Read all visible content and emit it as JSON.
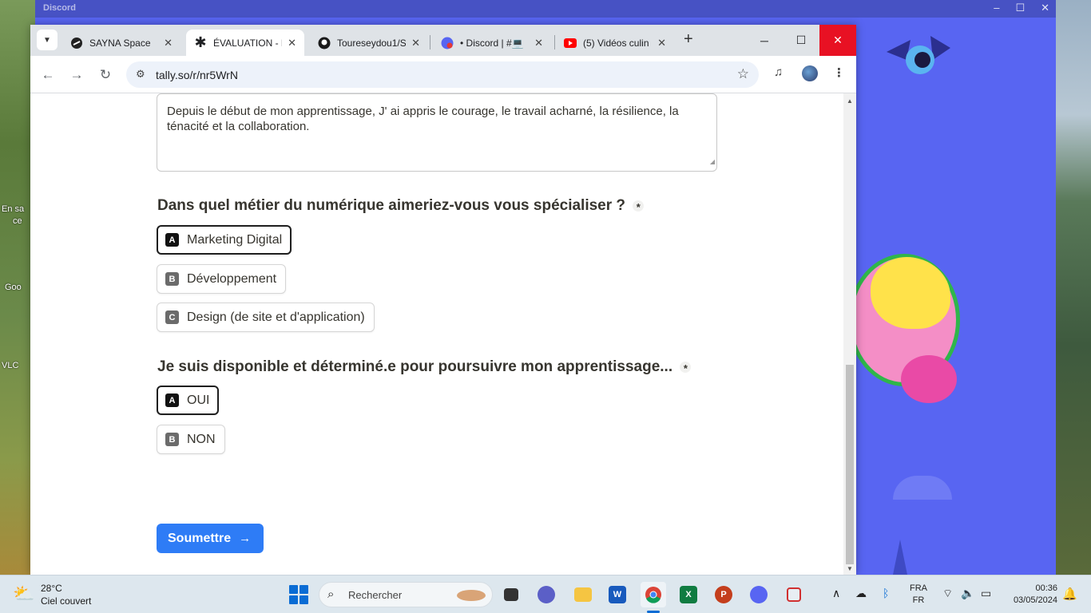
{
  "desktop": {
    "labels": [
      "En sa",
      "ce",
      "Goo",
      "VLC"
    ]
  },
  "discord": {
    "title": "Discord",
    "controls": [
      "–",
      "☐",
      "✕"
    ]
  },
  "browser": {
    "tabs": [
      {
        "title": "SAYNA Space",
        "favicon": "sayna-icon"
      },
      {
        "title": "ÉVALUATION - D",
        "favicon": "asterisk-icon",
        "active": true
      },
      {
        "title": "Toureseydou1/S",
        "favicon": "github-icon"
      },
      {
        "title": "• Discord | #💻",
        "favicon": "discord-icon"
      },
      {
        "title": "(5) Vidéos culin",
        "favicon": "youtube-icon"
      }
    ],
    "tab_close": "✕",
    "new_tab": "+",
    "window_controls": {
      "minimize": "─",
      "maximize": "☐",
      "close": "✕"
    },
    "url": "tally.so/r/nr5WrN"
  },
  "form": {
    "previous_answer": "Depuis le début de mon apprentissage, J' ai appris le courage, le travail acharné, la résilience, la ténacité et la collaboration.",
    "q1": {
      "text": "Dans quel métier du numérique aimeriez-vous vous spécialiser ?",
      "required_mark": "*",
      "options": [
        {
          "key": "A",
          "label": "Marketing Digital",
          "selected": true
        },
        {
          "key": "B",
          "label": "Développement",
          "selected": false
        },
        {
          "key": "C",
          "label": "Design (de site et d'application)",
          "selected": false
        }
      ]
    },
    "q2": {
      "text": "Je suis disponible et déterminé.e pour poursuivre mon apprentissage...",
      "required_mark": "*",
      "options": [
        {
          "key": "A",
          "label": "OUI",
          "selected": true
        },
        {
          "key": "B",
          "label": "NON",
          "selected": false
        }
      ]
    },
    "submit_label": "Soumettre"
  },
  "taskbar": {
    "weather_temp": "28°C",
    "weather_desc": "Ciel couvert",
    "search_label": "Rechercher",
    "lang_top": "FRA",
    "lang_bottom": "FR",
    "time": "00:36",
    "date": "03/05/2024",
    "apps": [
      "task-view",
      "teams",
      "file-explorer",
      "word",
      "chrome",
      "excel",
      "powerpoint",
      "discord",
      "snipping-tool"
    ]
  },
  "colors": {
    "discord": "#5865f2",
    "submit": "#2e7cf6",
    "close_red": "#e81123"
  }
}
